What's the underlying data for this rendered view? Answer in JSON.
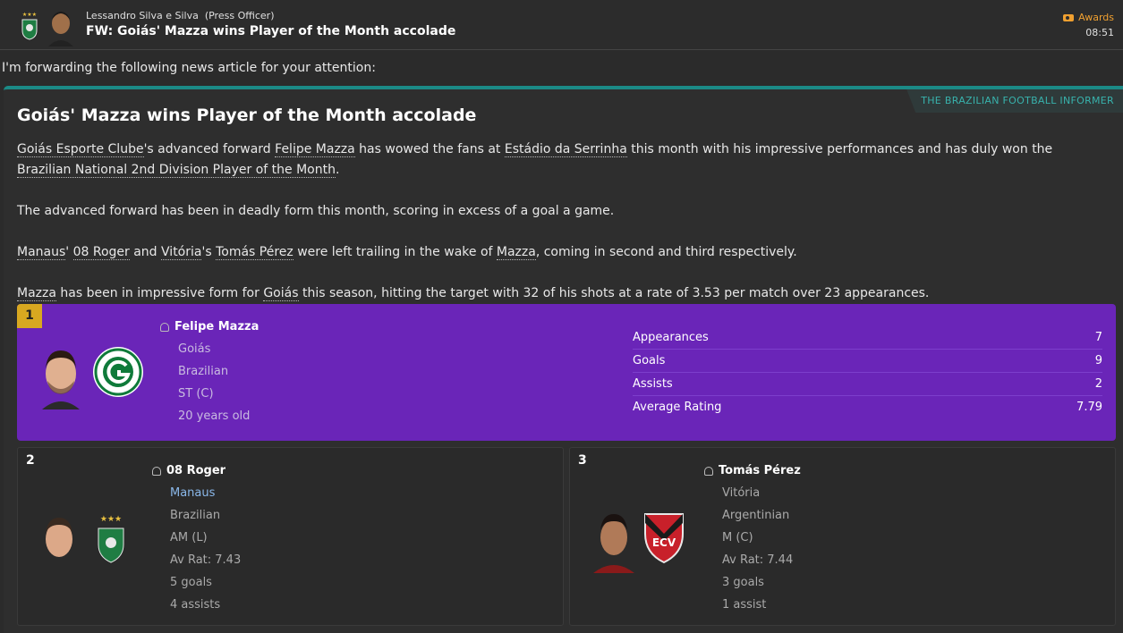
{
  "header": {
    "sender": "Lessandro Silva e Silva",
    "sender_role": "(Press Officer)",
    "subject": "FW: Goiás' Mazza wins Player of the Month accolade",
    "tag": "Awards",
    "time": "08:51"
  },
  "intro": "I'm forwarding the following news article for your attention:",
  "article": {
    "source": "THE BRAZILIAN FOOTBALL INFORMER",
    "headline": "Goiás' Mazza wins Player of the Month accolade",
    "p1": {
      "club": "Goiás Esporte Clube",
      "t1": "'s advanced forward ",
      "player": "Felipe Mazza",
      "t2": " has wowed the fans at ",
      "stadium": "Estádio da Serrinha",
      "t3": " this month with his impressive performances and has duly won the ",
      "award": "Brazilian National 2nd Division Player of the Month",
      "t4": "."
    },
    "p2": "The advanced forward has been in deadly form this month, scoring in excess of a goal a game.",
    "p3": {
      "club2": "Manaus",
      "t1": "' ",
      "player2": "08 Roger",
      "t2": " and ",
      "club3": "Vitória",
      "t3": "'s ",
      "player3": "Tomás Pérez",
      "t4": " were left trailing in the wake of ",
      "player1": "Mazza",
      "t5": ", coming in second and third respectively."
    },
    "p4": {
      "player1": "Mazza",
      "t1": " has been in impressive form for ",
      "club1": "Goiás",
      "t2": " this season, hitting the target with 32 of his shots at a rate of 3.53 per match over 23 appearances."
    }
  },
  "winner": {
    "rank": "1",
    "name": "Felipe Mazza",
    "club": "Goiás",
    "nationality": "Brazilian",
    "position": "ST (C)",
    "age": "20 years old",
    "stats": [
      {
        "label": "Appearances",
        "value": "7"
      },
      {
        "label": "Goals",
        "value": "9"
      },
      {
        "label": "Assists",
        "value": "2"
      },
      {
        "label": "Average Rating",
        "value": "7.79"
      }
    ]
  },
  "runners": [
    {
      "rank": "2",
      "name": "08 Roger",
      "club": "Manaus",
      "nationality": "Brazilian",
      "position": "AM (L)",
      "rating": "Av Rat: 7.43",
      "goals": "5 goals",
      "assists": "4 assists"
    },
    {
      "rank": "3",
      "name": "Tomás Pérez",
      "club": "Vitória",
      "nationality": "Argentinian",
      "position": "M (C)",
      "rating": "Av Rat: 7.44",
      "goals": "3 goals",
      "assists": "1 assist"
    }
  ],
  "colors": {
    "accent_teal": "#1b8a86",
    "winner_bg": "#6a25b8",
    "rank1_badge": "#d8a820",
    "tag_orange": "#f0a030",
    "goias_green": "#0f7a3a",
    "vitoria_red": "#c8202a"
  },
  "icons": [
    "goias-badge-icon",
    "person-icon",
    "awards-tag-icon",
    "manaus-crest-icon",
    "vitoria-crest-icon"
  ]
}
